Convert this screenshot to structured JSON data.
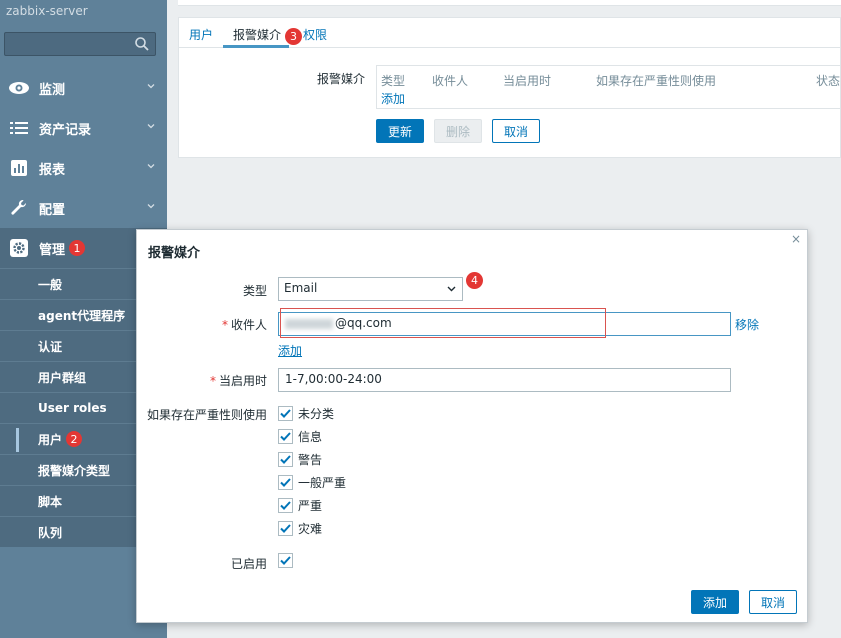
{
  "sidebar": {
    "brand": "zabbix-server",
    "menu": [
      {
        "label": "监测",
        "icon": "eye-icon"
      },
      {
        "label": "资产记录",
        "icon": "list-icon"
      },
      {
        "label": "报表",
        "icon": "bar-chart-icon"
      },
      {
        "label": "配置",
        "icon": "wrench-icon"
      },
      {
        "label": "管理",
        "icon": "gear-icon",
        "badge": "1"
      }
    ],
    "submenu": [
      "一般",
      "agent代理程序",
      "认证",
      "用户群组",
      "User roles",
      "用户",
      "报警媒介类型",
      "脚本",
      "队列"
    ],
    "submenu_badge": "2"
  },
  "tabs": [
    {
      "label": "用户"
    },
    {
      "label": "报警媒介"
    },
    {
      "label": "权限"
    }
  ],
  "tab_badge": "3",
  "media": {
    "label": "报警媒介",
    "columns": [
      "类型",
      "收件人",
      "当启用时",
      "如果存在严重性则使用",
      "状态"
    ],
    "add_link": "添加"
  },
  "buttons": {
    "update": "更新",
    "delete": "删除",
    "cancel": "取消"
  },
  "dialog": {
    "title": "报警媒介",
    "close": "×",
    "type_label": "类型",
    "type_value": "Email",
    "type_badge": "4",
    "recipient_label": "收件人",
    "recipient_suffix": "@qq.com",
    "remove_link": "移除",
    "add_link": "添加",
    "when_label": "当启用时",
    "when_value": "1-7,00:00-24:00",
    "severity_label": "如果存在严重性则使用",
    "severities": [
      "未分类",
      "信息",
      "警告",
      "一般严重",
      "严重",
      "灾难"
    ],
    "enabled_label": "已启用",
    "add_button": "添加",
    "cancel_button": "取消"
  },
  "colors": {
    "sidebar": "#5f8199",
    "primary": "#0275b8",
    "badge": "#e33734"
  }
}
